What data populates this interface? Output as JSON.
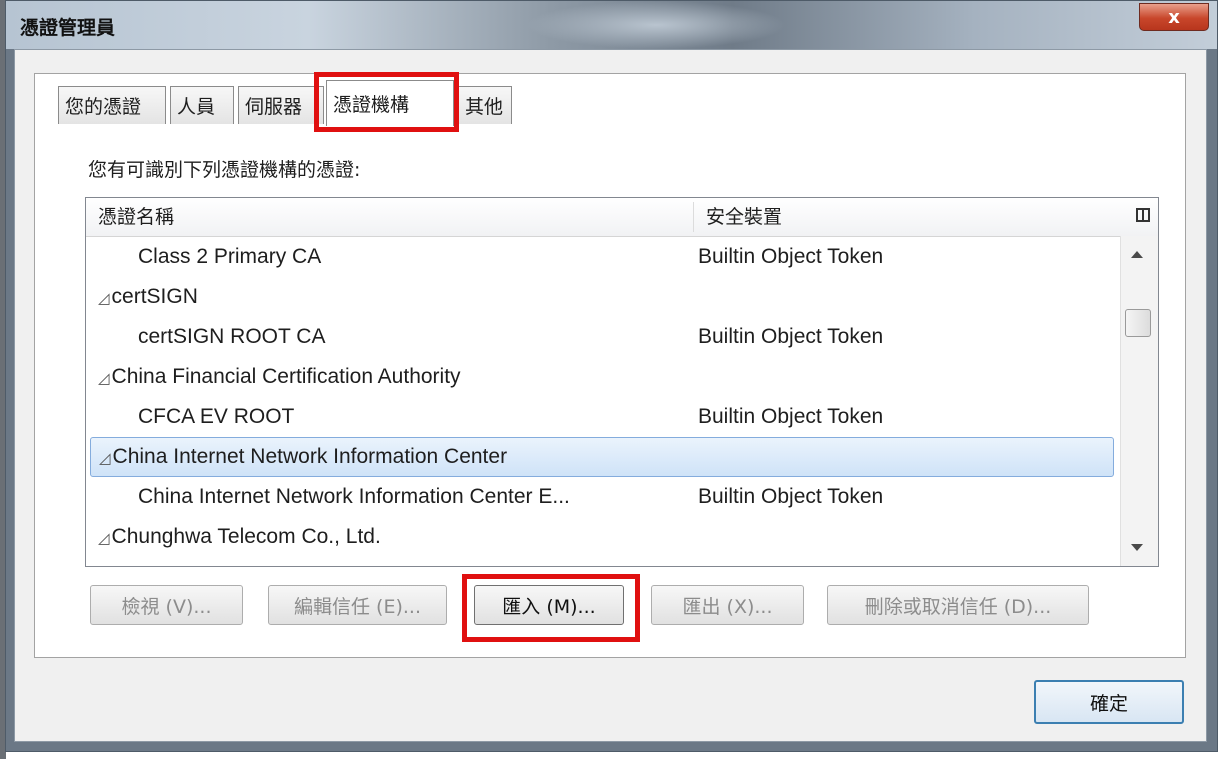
{
  "window": {
    "title": "憑證管理員",
    "close_label": "x"
  },
  "tabs": [
    {
      "label": "您的憑證"
    },
    {
      "label": "人員"
    },
    {
      "label": "伺服器"
    },
    {
      "label": "憑證機構",
      "active": true
    },
    {
      "label": "其他"
    }
  ],
  "description": "您有可識別下列憑證機構的憑證:",
  "table": {
    "columns": [
      "憑證名稱",
      "安全裝置"
    ],
    "rows": [
      {
        "name": "Class 2 Primary CA",
        "token": "Builtin Object Token",
        "group": false
      },
      {
        "name": "certSIGN",
        "token": "",
        "group": true
      },
      {
        "name": "certSIGN ROOT CA",
        "token": "Builtin Object Token",
        "group": false
      },
      {
        "name": "China Financial Certification Authority",
        "token": "",
        "group": true
      },
      {
        "name": "CFCA EV ROOT",
        "token": "Builtin Object Token",
        "group": false
      },
      {
        "name": "China Internet Network Information Center",
        "token": "",
        "group": true,
        "selected": true
      },
      {
        "name": "China Internet Network Information Center E...",
        "token": "Builtin Object Token",
        "group": false
      },
      {
        "name": "Chunghwa Telecom Co., Ltd.",
        "token": "",
        "group": true
      }
    ]
  },
  "buttons": {
    "view": "檢視 (V)...",
    "edit_trust": "編輯信任 (E)...",
    "import": "匯入 (M)...",
    "export": "匯出 (X)...",
    "delete": "刪除或取消信任 (D)...",
    "ok": "確定"
  },
  "colors": {
    "highlight": "#e01010",
    "selection": "#cfe3f8",
    "close_button": "#c8462b"
  }
}
